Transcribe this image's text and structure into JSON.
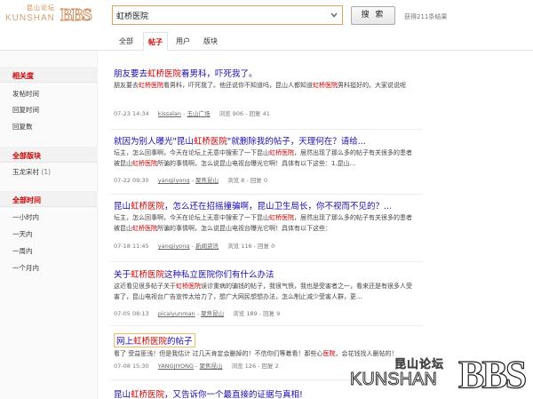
{
  "logo": {
    "cn": "昆山论坛",
    "en": "KUNSHAN",
    "bbs": "BBS"
  },
  "search": {
    "value": "虹桥医院",
    "button": "搜 索",
    "result_count": "获得211条结果"
  },
  "tabs": [
    {
      "label": "全部"
    },
    {
      "label": "帖子"
    },
    {
      "label": "用户"
    },
    {
      "label": "版块"
    }
  ],
  "sidebar": {
    "sort": {
      "title": "相关度",
      "items": [
        "发帖时间",
        "回复时间",
        "回复数"
      ]
    },
    "boards": {
      "title": "全部版块",
      "items": [
        {
          "label": "玉龙宋村",
          "count": "(1)"
        }
      ]
    },
    "time": {
      "title": "全部时间",
      "items": [
        "一小时内",
        "一天内",
        "一周内",
        "一个月内"
      ]
    }
  },
  "results": [
    {
      "title_pre": "朋友要去",
      "title_hl": "虹桥医院",
      "title_post": "看男科，吓死我了。",
      "snippet_1": "朋友要去",
      "snippet_hl1": "虹桥医院",
      "snippet_2": "看男科，吓死我了。他还说你不知道吗，昆山人都知道",
      "snippet_hl2": "虹桥医院",
      "snippet_3": "男科挺好的。大家说说呢",
      "date": "07-23 14:34",
      "user": "kissalan",
      "board": "玉山广场",
      "stats": "浏览 906 - 回复 41"
    },
    {
      "title_pre": "就因为别人曝光\"昆山",
      "title_hl": "虹桥医院",
      "title_post": "\"就删除我的帖子，天理何在？请给...",
      "snippet_1": "坛主，怎么回事啊，今天在论坛上无意中搜索了一下昆山",
      "snippet_hl1": "虹桥医院",
      "snippet_2": "，居然出现了那么多的帖子有关很多的患者被昆山",
      "snippet_hl2": "虹桥医院",
      "snippet_3": "所骗的事情啊，怎么说昆山电视台曝光它啊！具体有以下这些：1.昆山...",
      "date": "07-22 09:30",
      "user": "yangjiyong",
      "board": "聚焦昆山",
      "stats": "浏览 8 - 回复 0"
    },
    {
      "title_pre": "昆山",
      "title_hl": "虹桥医院",
      "title_post": "，怎么还在招摇撞骗啊，昆山卫生局长，你不视而不见的？...",
      "snippet_1": "坛主，怎么回事啊，今天在论坛上无意中搜索了一下昆山",
      "snippet_hl1": "虹桥医院",
      "snippet_2": "，居然出现了那么多的帖子有关很多的患者被昆山",
      "snippet_hl2": "虹桥医院",
      "snippet_3": "所骗的事情啊，怎么说昆山电视台曝光它啊！具体有以下这些：",
      "date": "07-18 11:45",
      "user": "yangjiyong",
      "board": "新闻资讯",
      "stats": "浏览 116 - 回复 0"
    },
    {
      "title_pre": "关于",
      "title_hl": "虹桥医院",
      "title_post": "这种私立医院你们有什么办法",
      "snippet_1": "这近看见很多帖子关于",
      "snippet_hl1": "虹桥医院",
      "snippet_2": "误诊重病的骗钱的帖子，我很气愤，我也是受害者之一，看来还是有很多人受害了，昆山电视台广告宣传太给力了，想广大网民想想办法，怎么制止减少受害人群，更...",
      "snippet_hl2": "",
      "snippet_3": "",
      "date": "07-05 08:13",
      "user": "picaiyunman",
      "board": "聚焦昆山",
      "stats": "浏览 189 - 回复 9"
    },
    {
      "title_pre": "网上",
      "title_hl": "虹桥医院",
      "title_post": "的帖子",
      "snippet_1": "看了 受益匪浅！但是我估计 过几天肯定会删掉的！不信你们等着看！那些心",
      "snippet_hl1": "医院",
      "snippet_2": "，会花钱找人删帖的！",
      "snippet_hl2": "",
      "snippet_3": "",
      "date": "07-08 15:30",
      "user": "YANGJIYONG",
      "board": "聚焦昆山",
      "stats": "浏览 126 - 回复 2"
    },
    {
      "title_pre": "昆山",
      "title_hl": "虹桥医院",
      "title_post": "，又告诉你一个最直接的证据与真相!",
      "snippet_1": "",
      "snippet_hl1": "",
      "snippet_2": "",
      "snippet_hl2": "",
      "snippet_3": "",
      "date": "",
      "user": "",
      "board": "",
      "stats": ""
    }
  ],
  "watermark": {
    "cn": "昆山论坛",
    "en": "KUNSHAN",
    "bbs": "BBS"
  },
  "colors": {
    "accent": "#cc0000",
    "link": "#1a0dab",
    "orange": "#e0a060"
  }
}
